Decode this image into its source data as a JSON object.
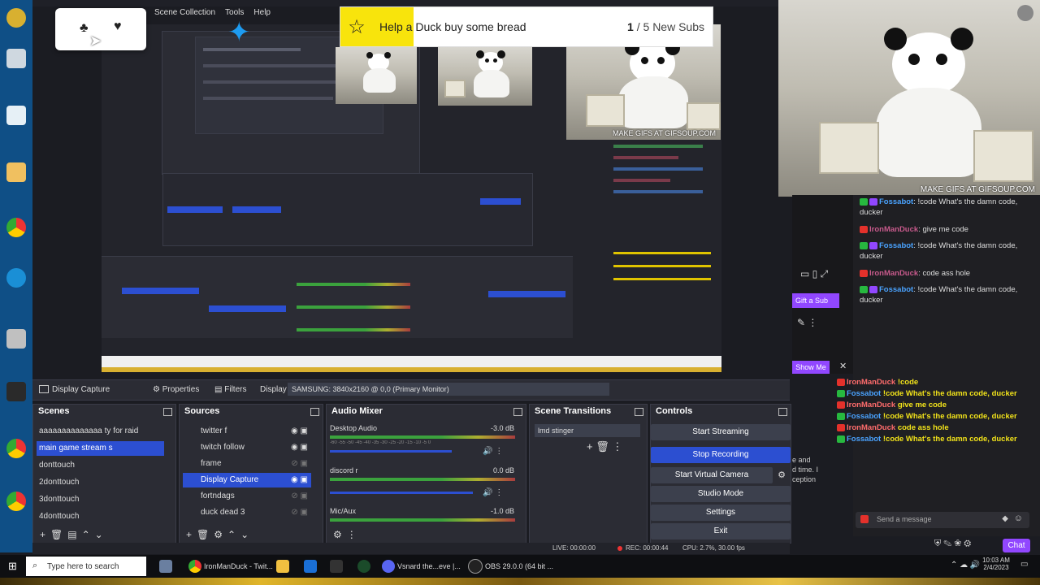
{
  "goal": {
    "text": "Help a Duck buy some bread",
    "count_current": "1",
    "count_rest": " / 5 New Subs",
    "progress_fraction": 0.2
  },
  "obs": {
    "menu": [
      "Scene Collection",
      "Tools",
      "Help"
    ],
    "source_bar": {
      "source_name": "Display Capture",
      "properties": "Properties",
      "filters": "Filters",
      "display_label": "Display",
      "display_value": "SAMSUNG: 3840x2160 @ 0,0 (Primary Monitor)"
    },
    "scenes": {
      "title": "Scenes",
      "items": [
        "aaaaaaaaaaaaaa ty for raid",
        "main game stream s",
        "donttouch",
        "2donttouch",
        "3donttouch",
        "4donttouch"
      ],
      "selected_index": 1
    },
    "sources": {
      "title": "Sources",
      "items": [
        "twitter f",
        "twitch follow",
        "frame",
        "Display Capture",
        "fortndags",
        "duck dead 3"
      ],
      "selected_index": 3
    },
    "mixer": {
      "title": "Audio Mixer",
      "channels": [
        {
          "name": "Desktop Audio",
          "db": "-3.0 dB"
        },
        {
          "name": "discord r",
          "db": "0.0 dB"
        },
        {
          "name": "Mic/Aux",
          "db": "-1.0 dB"
        }
      ],
      "ticks": "-60 -55 -50 -45 -40 -35 -30 -25 -20 -15 -10 -5 0"
    },
    "transitions": {
      "title": "Scene Transitions",
      "value": "lmd stinger"
    },
    "controls": {
      "title": "Controls",
      "start_streaming": "Start Streaming",
      "stop_recording": "Stop Recording",
      "virtual_camera": "Start Virtual Camera",
      "studio_mode": "Studio Mode",
      "settings": "Settings",
      "exit": "Exit"
    },
    "status": {
      "live": "LIVE: 00:00:00",
      "rec": "REC: 00:00:44",
      "cpu": "CPU: 2.7%, 30.00 fps"
    }
  },
  "chat": {
    "lines": [
      {
        "user": "Fossabot",
        "user_color": "blue",
        "msg": ": !code What's the damn code, ducker"
      },
      {
        "user": "IronManDuck",
        "user_color": "red",
        "msg": ": give me code"
      },
      {
        "user": "Fossabot",
        "user_color": "blue",
        "msg": ": !code What's the damn code, ducker"
      },
      {
        "user": "IronManDuck",
        "user_color": "red",
        "msg": ": code ass hole"
      },
      {
        "user": "Fossabot",
        "user_color": "blue",
        "msg": ": !code What's the damn code, ducker"
      }
    ],
    "gift_sub": "Gift a Sub",
    "show_me": "Show Me",
    "partial": [
      "e and",
      "d time. I",
      "ception"
    ],
    "send_placeholder": "Send a message",
    "chat_button": "Chat"
  },
  "yellow_chat": [
    {
      "user": "IronManDuck",
      "msg": "!code"
    },
    {
      "user": "Fossabot",
      "msg": "!code What's the damn code, ducker"
    },
    {
      "user": "IronManDuck",
      "msg": "give me code"
    },
    {
      "user": "Fossabot",
      "msg": "!code What's the damn code, ducker"
    },
    {
      "user": "IronManDuck",
      "msg": "code ass hole"
    },
    {
      "user": "Fossabot",
      "msg": "!code What's the damn code, ducker"
    }
  ],
  "gif_watermark": "MAKE GIFS AT GIFSOUP.COM",
  "taskbar": {
    "search": "Type here to search",
    "apps": [
      "IronManDuck - Twit...",
      "Vsnard the...eve |...",
      "OBS 29.0.0 (64 bit ..."
    ],
    "time": "10:03 AM",
    "date": "2/4/2023"
  },
  "colors": {
    "accent": "#2c4fd1",
    "goal_fill": "#f8e40c",
    "chat_yellow": "#f2e31a",
    "twitch_purple": "#9147ff"
  }
}
